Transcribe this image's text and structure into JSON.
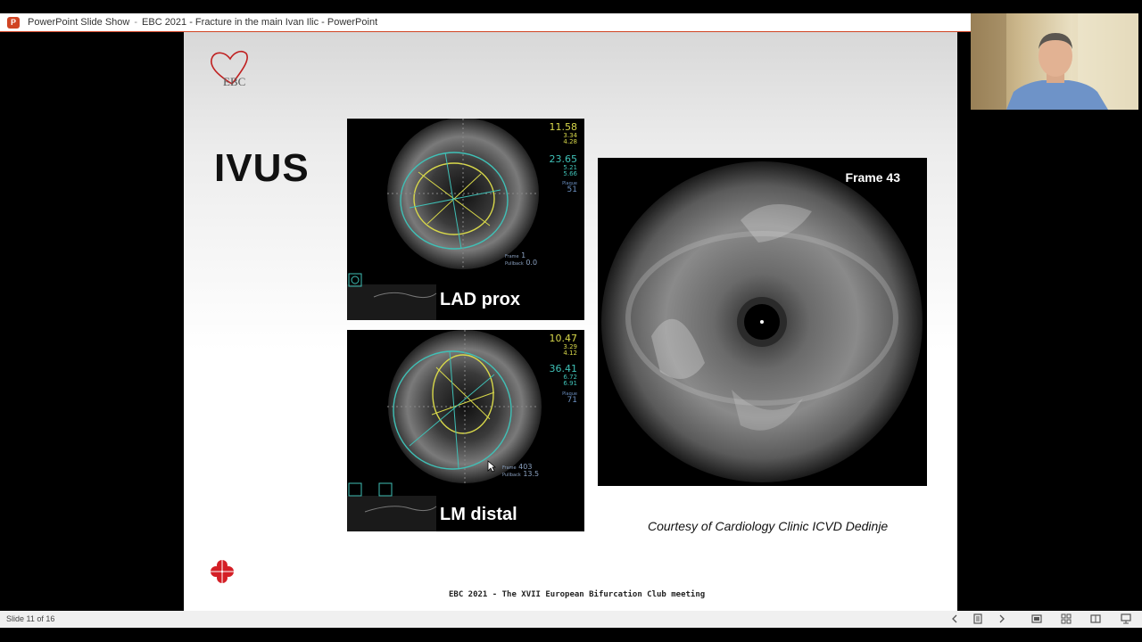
{
  "window": {
    "app_name": "PowerPoint Slide Show",
    "separator": "-",
    "doc_title": "EBC 2021 - Fracture in the main Ivan Ilic - PowerPoint"
  },
  "slide": {
    "logo_text": "EBC",
    "title": "IVUS",
    "panel_top": {
      "label": "LAD prox",
      "meas1": [
        "11.58",
        "3.34",
        "4.28"
      ],
      "meas2": [
        "23.65",
        "5.21",
        "5.66"
      ],
      "plaque_label": "Plaque",
      "plaque_value": "51",
      "frame_label": "Frame",
      "frame_value": "1",
      "pullback_label": "Pullback",
      "pullback_value": "0.0"
    },
    "panel_bottom": {
      "label": "LM distal",
      "meas1": [
        "10.47",
        "3.29",
        "4.12"
      ],
      "meas2": [
        "36.41",
        "6.72",
        "6.91"
      ],
      "plaque_label": "Plaque",
      "plaque_value": "71",
      "frame_label": "Frame",
      "frame_value": "403",
      "pullback_label": "Pullback",
      "pullback_value": "13.5"
    },
    "large_panel_label": "Frame 43",
    "courtesy": "Courtesy of Cardiology Clinic ICVD Dedinje",
    "footer": "EBC 2021 - The XVII European Bifurcation Club meeting"
  },
  "status": {
    "slide_count": "Slide 11 of 16"
  },
  "colors": {
    "accent": "#d04423",
    "yellow_measure": "#d8d84a",
    "cyan_measure": "#3fc0b6"
  }
}
